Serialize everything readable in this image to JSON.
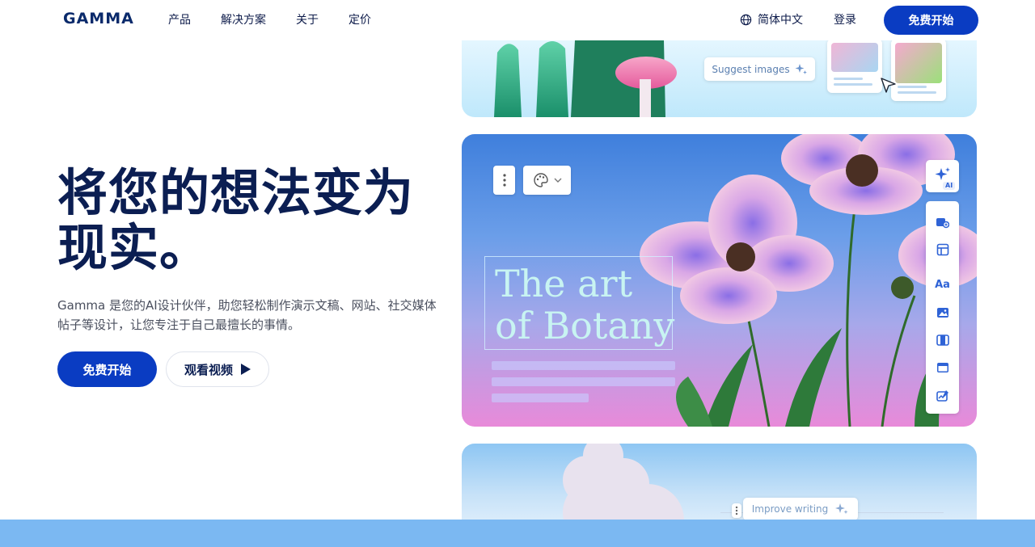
{
  "nav": {
    "logo": "GAMMA",
    "menu": [
      "产品",
      "解决方案",
      "关于",
      "定价"
    ],
    "language": "简体中文",
    "login": "登录",
    "cta": "免费开始"
  },
  "hero": {
    "title_line1": "将您的想法变为",
    "title_line2": "现实。",
    "subtitle": "Gamma 是您的AI设计伙伴，助您轻松制作演示文稿、网站、社交媒体帖子等设计，让您专注于自己最擅长的事情。",
    "cta_primary": "免费开始",
    "cta_video": "观看视频"
  },
  "cards": {
    "suggest_images": "Suggest images",
    "art_title_line1": "The art",
    "art_title_line2": "of Botany",
    "ai_badge": "AI",
    "tools_typography": "Aa",
    "improve_writing": "Improve writing"
  },
  "colors": {
    "brand": "#0a3cc2",
    "heading": "#0b1e52",
    "footer_strip": "#7bb8f2"
  }
}
